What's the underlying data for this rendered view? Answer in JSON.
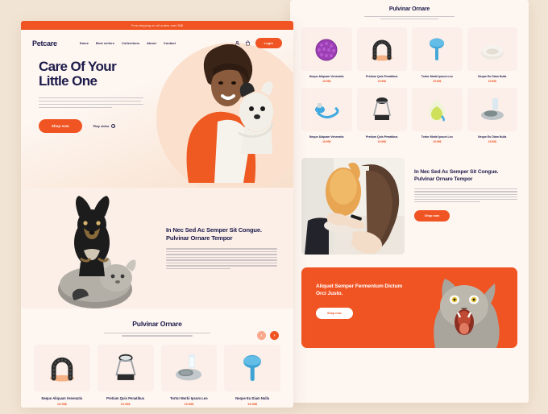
{
  "meta": {
    "page_background": "#f2e4d4",
    "accent": "#f05423",
    "navy": "#1d1b4b",
    "cream": "#fdf6f1"
  },
  "left_page": {
    "announcement": "Free shipping on all orders over 50$",
    "logo": "Petcare",
    "nav": [
      {
        "label": "Home"
      },
      {
        "label": "Best sellers"
      },
      {
        "label": "Collections"
      },
      {
        "label": "About"
      },
      {
        "label": "Contact"
      }
    ],
    "account_icon": "user-icon",
    "cart_icon": "shopping-bag-icon",
    "login_label": "Login",
    "hero": {
      "title_line1": "Care Of Your",
      "title_line2": "Little One",
      "paragraph": "Stay goodbye to the discomfort and debilitating pain caused by migraines, sinus headaches, and puffy eyes. Introducing our Migraine Relief Hat: a versatile, wearable, and flexible cooling hat designed to provide targeted relief where you need it most.",
      "cta_label": "Shop now",
      "play_label": "Play video",
      "play_icon": "play-circle-icon",
      "image_alt": "woman-holding-puppy"
    },
    "about": {
      "heading": "In Nec Sed Ac Semper Sit Congue. Pulvinar Ornare Tempor",
      "paragraph": "Nibh odio congue vitae ullamcorper lacus scelerisque. Lorem pretium tincidunt cursus magna tempor ornare. Eget scelerisque viverra amet nisl viverra nam. Nisl morbi accumsan felis sapien condimentum velit eget. Sit donec mauris nisl at vestibulum vitae aliquam. Sem euismod tempus semper in habitasse at massa cum. Sem nam cursus vestibulum iaculis morbi ultrices tortor sit pretium. Vitae aliquam lorem turpis ornare aenean tortor quis.",
      "image_alt": "dog-sitting-on-cat"
    },
    "products_section": {
      "title": "Pulvinar Ornare",
      "subtitle": "Massa mi sapien pharetra amet nullam cum enim lectus. Porta at facilisi integer nibh tortor non odio turpis.",
      "prev_icon": "chevron-left-icon",
      "next_icon": "chevron-right-icon",
      "items": [
        {
          "name": "Neque Aliquam Venenatis",
          "price": "19.99$",
          "image": "arch-grooming-toy"
        },
        {
          "name": "Pretium Quis Penatibus",
          "price": "19.99$",
          "image": "deshedding-brush"
        },
        {
          "name": "Tortor Morbi Ipsum Leo",
          "price": "19.99$",
          "image": "water-fountain-bowl"
        },
        {
          "name": "Neque Eu Diam Nulla",
          "price": "19.99$",
          "image": "blue-slicker-brush"
        }
      ]
    }
  },
  "right_page": {
    "products_section": {
      "title": "Pulvinar Ornare",
      "subtitle": "Massa mi sapien pharetra amet nullam cum enim lectus. Porta at facilisi integer nibh tortor non odio turpis.",
      "items": [
        {
          "name": "Neque Aliquam Venenatis",
          "price": "19.99$",
          "image": "purple-massage-ball"
        },
        {
          "name": "Pretium Quis Penatibus",
          "price": "19.99$",
          "image": "arch-grooming-toy"
        },
        {
          "name": "Tortor Morbi Ipsum Leo",
          "price": "19.99$",
          "image": "blue-slicker-brush"
        },
        {
          "name": "Neque Eu Diam Nulla",
          "price": "19.99$",
          "image": "white-pet-bed"
        },
        {
          "name": "Neque Aliquam Venenatis",
          "price": "19.99$",
          "image": "blue-hose-sprayer"
        },
        {
          "name": "Pretium Quis Penatibus",
          "price": "19.99$",
          "image": "deshedding-brush"
        },
        {
          "name": "Tortor Morbi Ipsum Leo",
          "price": "19.99$",
          "image": "green-water-bottle"
        },
        {
          "name": "Neque Eu Diam Nulla",
          "price": "19.99$",
          "image": "water-fountain-bowl"
        }
      ]
    },
    "feature": {
      "heading": "In Nec Sed Ac Semper Sit Congue. Pulvinar Ornare Tempor",
      "paragraph": "Nibh odio congue vitae ullamcorper lacus scelerisque. Lorem pretium tincidunt cursus magna tempor ornare. Eget scelerisque viverra amet nisl viverra nam. Nisl morbi accumsan felis sapien condimentum velit eget donec mauris nisl at vestibulum vitae aliquam lorem turpis ornare aenean.",
      "cta_label": "Shop now",
      "image_alt": "grooming-cat-nails"
    },
    "cta_banner": {
      "heading": "Aliquet Semper Fermentum Dictum Orci Justo.",
      "cta_label": "Shop now",
      "image_alt": "grey-cat-yawning"
    }
  }
}
